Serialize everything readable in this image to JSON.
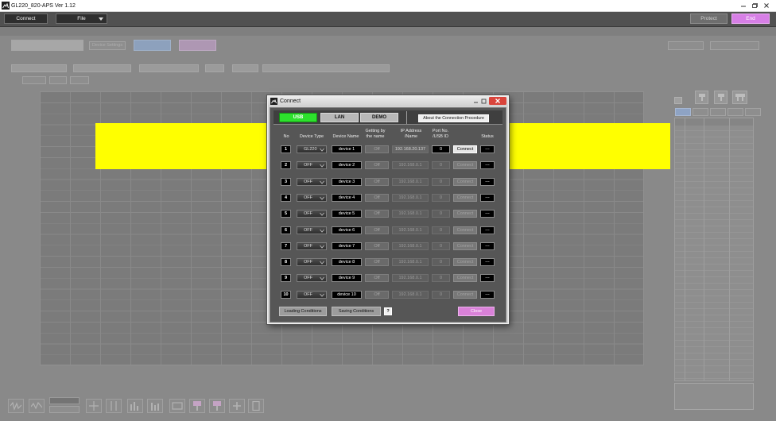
{
  "window": {
    "title": "GL220_820-APS Ver 1.12"
  },
  "toolbar": {
    "connect_label": "Connect",
    "file_label": "File",
    "protect_label": "Protect",
    "end_label": "End"
  },
  "settings_bar": {
    "device_settings_label": "Device Settings"
  },
  "colors": {
    "highlight": "#ffff00",
    "usb_tab_active": "#2de12d",
    "end_button": "#d77fe6",
    "dialog_close_button": "#d981d8",
    "window_close_red": "#d9443b"
  },
  "icons": {
    "window_controls": [
      "minimize-icon",
      "maximize-icon",
      "close-icon"
    ],
    "device_type_dropdown": "chevron-down-icon"
  },
  "dialog": {
    "title": "Connect",
    "tabs": [
      {
        "label": "USB",
        "active": true
      },
      {
        "label": "LAN",
        "active": false
      },
      {
        "label": "DEMO",
        "active": false
      }
    ],
    "about_label": "About the Connection Procedure",
    "headers": {
      "no": "No",
      "device_type": "Device Type",
      "device_name": "Device Name",
      "getting_by_name_line1": "Getting by",
      "getting_by_name_line2": "the name",
      "ip_line1": "IP Address",
      "ip_line2": "/Name",
      "port_line1": "Port No.",
      "port_line2": "/USB ID",
      "status": "Status"
    },
    "rows": [
      {
        "no": "1",
        "device_type": "GL220",
        "device_name": "device 1",
        "getting_by_name": "Off",
        "ip": "192.168.20.137",
        "port": "0",
        "connect_label": "Connect",
        "status": "---",
        "enabled": true
      },
      {
        "no": "2",
        "device_type": "OFF",
        "device_name": "device 2",
        "getting_by_name": "Off",
        "ip": "192.168.0.1",
        "port": "0",
        "connect_label": "Connect",
        "status": "---",
        "enabled": false
      },
      {
        "no": "3",
        "device_type": "OFF",
        "device_name": "device 3",
        "getting_by_name": "Off",
        "ip": "192.168.0.1",
        "port": "0",
        "connect_label": "Connect",
        "status": "---",
        "enabled": false
      },
      {
        "no": "4",
        "device_type": "OFF",
        "device_name": "device 4",
        "getting_by_name": "Off",
        "ip": "192.168.0.1",
        "port": "0",
        "connect_label": "Connect",
        "status": "---",
        "enabled": false
      },
      {
        "no": "5",
        "device_type": "OFF",
        "device_name": "device 5",
        "getting_by_name": "Off",
        "ip": "192.168.0.1",
        "port": "0",
        "connect_label": "Connect",
        "status": "---",
        "enabled": false
      },
      {
        "no": "6",
        "device_type": "OFF",
        "device_name": "device 6",
        "getting_by_name": "Off",
        "ip": "192.168.0.1",
        "port": "0",
        "connect_label": "Connect",
        "status": "---",
        "enabled": false
      },
      {
        "no": "7",
        "device_type": "OFF",
        "device_name": "device 7",
        "getting_by_name": "Off",
        "ip": "192.168.0.1",
        "port": "0",
        "connect_label": "Connect",
        "status": "---",
        "enabled": false
      },
      {
        "no": "8",
        "device_type": "OFF",
        "device_name": "device 8",
        "getting_by_name": "Off",
        "ip": "192.168.0.1",
        "port": "0",
        "connect_label": "Connect",
        "status": "---",
        "enabled": false
      },
      {
        "no": "9",
        "device_type": "OFF",
        "device_name": "device 9",
        "getting_by_name": "Off",
        "ip": "192.168.0.1",
        "port": "0",
        "connect_label": "Connect",
        "status": "---",
        "enabled": false
      },
      {
        "no": "10",
        "device_type": "OFF",
        "device_name": "device 10",
        "getting_by_name": "Off",
        "ip": "192.168.0.1",
        "port": "0",
        "connect_label": "Connect",
        "status": "---",
        "enabled": false
      }
    ],
    "footer": {
      "loading_label": "Loading Conditions",
      "saving_label": "Saving Conditions",
      "help_label": "?",
      "close_label": "Close"
    }
  }
}
